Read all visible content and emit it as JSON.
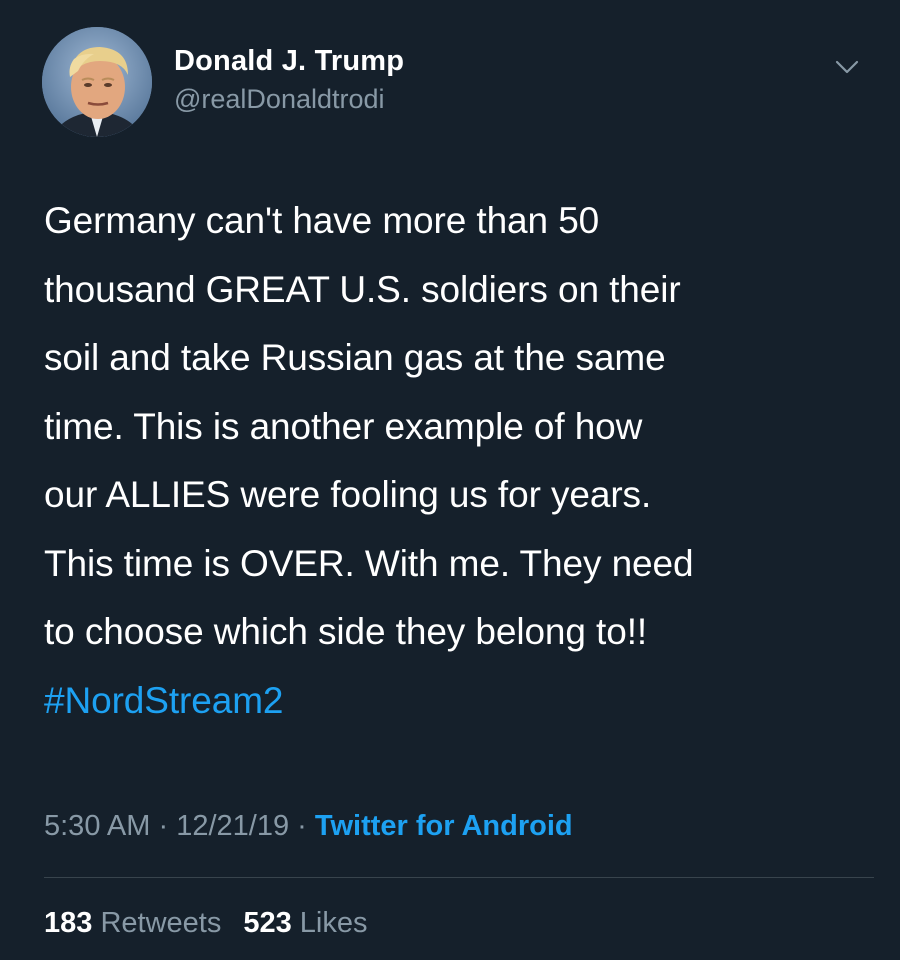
{
  "user": {
    "display_name": "Donald J. Trump",
    "handle": "@realDonaldtrodi"
  },
  "tweet": {
    "lines": [
      "Germany can't have more than 50",
      "thousand GREAT U.S. soldiers on their",
      "soil and take Russian gas at the same",
      "time. This is another example of how",
      "our ALLIES were fooling us for years.",
      "This time is OVER. With me. They need",
      "to choose which side they belong to!!"
    ],
    "hashtag": "#NordStream2"
  },
  "meta": {
    "time": "5:30 AM",
    "date": "12/21/19",
    "separator": "·",
    "source": "Twitter for Android"
  },
  "stats": {
    "retweets_count": "183",
    "retweets_label": "Retweets",
    "likes_count": "523",
    "likes_label": "Likes"
  },
  "icons": {
    "menu": "chevron-down-icon"
  },
  "colors": {
    "background": "#15202b",
    "text": "#ffffff",
    "secondary": "#8899a6",
    "link": "#1da1f2",
    "divider": "#38444d"
  }
}
